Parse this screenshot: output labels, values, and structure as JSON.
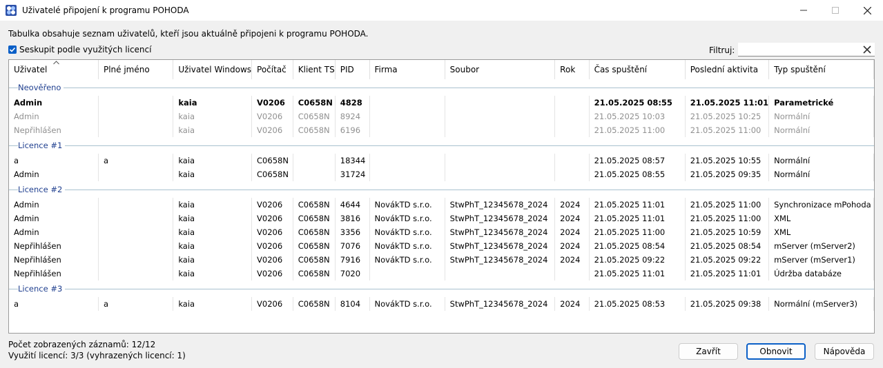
{
  "window": {
    "title": "Uživatelé připojení k programu POHODA"
  },
  "info_text": "Tabulka obsahuje seznam uživatelů, kteří jsou aktuálně připojeni k programu POHODA.",
  "group_checkbox": {
    "label": "Seskupit podle využitých licencí",
    "checked": true
  },
  "filter": {
    "label": "Filtruj:",
    "value": ""
  },
  "columns": [
    "Uživatel",
    "Plné jméno",
    "Uživatel Windows",
    "Počítač",
    "Klient TS",
    "PID",
    "Firma",
    "Soubor",
    "Rok",
    "Čas spuštění",
    "Poslední aktivita",
    "Typ spuštění"
  ],
  "groups": [
    {
      "label": "Neověřeno",
      "rows": [
        {
          "style": "bold",
          "cells": [
            "Admin",
            "",
            "kaia",
            "V0206",
            "C0658N",
            "4828",
            "",
            "",
            "",
            "21.05.2025 08:55",
            "21.05.2025 11:01",
            "Parametrické"
          ]
        },
        {
          "style": "grey",
          "cells": [
            "Admin",
            "",
            "kaia",
            "V0206",
            "C0658N",
            "8924",
            "",
            "",
            "",
            "21.05.2025 10:03",
            "21.05.2025 10:25",
            "Normální"
          ]
        },
        {
          "style": "grey",
          "cells": [
            "Nepřihlášen",
            "",
            "kaia",
            "V0206",
            "C0658N",
            "6196",
            "",
            "",
            "",
            "21.05.2025 11:00",
            "21.05.2025 11:00",
            "Normální"
          ]
        }
      ]
    },
    {
      "label": "Licence #1",
      "rows": [
        {
          "style": "",
          "cells": [
            "a",
            "a",
            "kaia",
            "C0658N",
            "",
            "18344",
            "",
            "",
            "",
            "21.05.2025 08:57",
            "21.05.2025 10:55",
            "Normální"
          ]
        },
        {
          "style": "",
          "cells": [
            "Admin",
            "",
            "kaia",
            "C0658N",
            "",
            "31724",
            "",
            "",
            "",
            "21.05.2025 08:55",
            "21.05.2025 09:35",
            "Normální"
          ]
        }
      ]
    },
    {
      "label": "Licence #2",
      "rows": [
        {
          "style": "",
          "cells": [
            "Admin",
            "",
            "kaia",
            "V0206",
            "C0658N",
            "4644",
            "NovákTD s.r.o.",
            "StwPhT_12345678_2024",
            "2024",
            "21.05.2025 11:01",
            "21.05.2025 11:00",
            "Synchronizace mPohoda"
          ]
        },
        {
          "style": "",
          "cells": [
            "Admin",
            "",
            "kaia",
            "V0206",
            "C0658N",
            "3816",
            "NovákTD s.r.o.",
            "StwPhT_12345678_2024",
            "2024",
            "21.05.2025 11:01",
            "21.05.2025 11:00",
            "XML"
          ]
        },
        {
          "style": "",
          "cells": [
            "Admin",
            "",
            "kaia",
            "V0206",
            "C0658N",
            "3356",
            "NovákTD s.r.o.",
            "StwPhT_12345678_2024",
            "2024",
            "21.05.2025 11:00",
            "21.05.2025 10:59",
            "XML"
          ]
        },
        {
          "style": "",
          "cells": [
            "Nepřihlášen",
            "",
            "kaia",
            "V0206",
            "C0658N",
            "7076",
            "NovákTD s.r.o.",
            "StwPhT_12345678_2024",
            "2024",
            "21.05.2025 08:54",
            "21.05.2025 08:54",
            "mServer (mServer2)"
          ]
        },
        {
          "style": "",
          "cells": [
            "Nepřihlášen",
            "",
            "kaia",
            "V0206",
            "C0658N",
            "7916",
            "NovákTD s.r.o.",
            "StwPhT_12345678_2024",
            "2024",
            "21.05.2025 09:22",
            "21.05.2025 09:22",
            "mServer (mServer1)"
          ]
        },
        {
          "style": "",
          "cells": [
            "Nepřihlášen",
            "",
            "kaia",
            "V0206",
            "C0658N",
            "7020",
            "",
            "",
            "",
            "21.05.2025 11:01",
            "21.05.2025 11:01",
            "Údržba databáze"
          ]
        }
      ]
    },
    {
      "label": "Licence #3",
      "rows": [
        {
          "style": "",
          "cells": [
            "a",
            "a",
            "kaia",
            "V0206",
            "C0658N",
            "8104",
            "NovákTD s.r.o.",
            "StwPhT_12345678_2024",
            "2024",
            "21.05.2025 08:53",
            "21.05.2025 09:38",
            "Normální (mServer3)"
          ]
        }
      ]
    }
  ],
  "status": {
    "records": "Počet zobrazených záznamů: 12/12",
    "licenses": "Využití licencí: 3/3 (vyhrazených licencí: 1)"
  },
  "buttons": {
    "close": "Zavřít",
    "refresh": "Obnovit",
    "help": "Nápověda"
  },
  "colors": {
    "accent": "#0a5fc7",
    "group_text": "#1f3f8f"
  }
}
